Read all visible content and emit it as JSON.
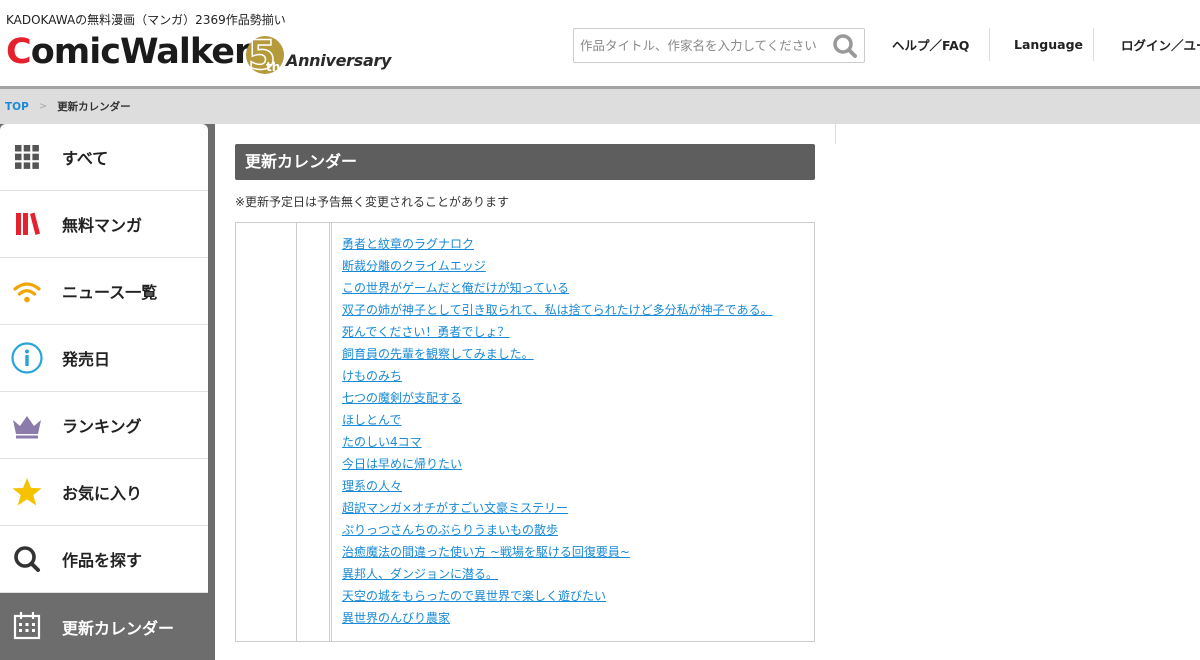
{
  "header": {
    "tagline": "KADOKAWAの無料漫画（マンガ）2369作品勢揃い",
    "logo": {
      "first_letter": "C",
      "rest": "omicWalker",
      "anniv_number": "5",
      "anniv_suffix": "th",
      "anniv_word": "Anniversary"
    },
    "search": {
      "placeholder": "作品タイトル、作家名を入力してください",
      "value": ""
    },
    "nav": {
      "help": "ヘルプ／FAQ",
      "language": "Language",
      "login": "ログイン／ユー"
    },
    "colors": {
      "logo_red": "#e4212d",
      "anniv_gold": "#b59a3b"
    }
  },
  "breadcrumb": {
    "top": "TOP",
    "separator": ">",
    "current": "更新カレンダー"
  },
  "sidebar": {
    "items": [
      {
        "label": "すべて",
        "icon": "grid-icon"
      },
      {
        "label": "無料マンガ",
        "icon": "books-icon"
      },
      {
        "label": "ニュース一覧",
        "icon": "wifi-icon"
      },
      {
        "label": "発売日",
        "icon": "info-icon"
      },
      {
        "label": "ランキング",
        "icon": "crown-icon"
      },
      {
        "label": "お気に入り",
        "icon": "star-icon"
      },
      {
        "label": "作品を探す",
        "icon": "search-icon"
      },
      {
        "label": "更新カレンダー",
        "icon": "calendar-icon",
        "active": true
      }
    ]
  },
  "main": {
    "title": "更新カレンダー",
    "notice": "※更新予定日は予告無く変更されることがあります",
    "titles": [
      "勇者と紋章のラグナロク",
      "断裁分離のクライムエッジ",
      "この世界がゲームだと俺だけが知っている",
      "双子の姉が神子として引き取られて、私は捨てられたけど多分私が神子である。",
      "死んでください！勇者でしょ？",
      "飼育員の先輩を観察してみました。",
      "けものみち",
      "七つの魔剣が支配する",
      "ほしとんで",
      "たのしい4コマ",
      "今日は早めに帰りたい",
      "理系の人々",
      "超訳マンガ×オチがすごい文豪ミステリー",
      "ぷりっつさんちのぶらりうまいもの散歩",
      "治癒魔法の間違った使い方 ~戦場を駆ける回復要員~",
      "異邦人、ダンジョンに潜る。",
      "天空の城をもらったので異世界で楽しく遊びたい",
      "異世界のんびり農家"
    ]
  }
}
